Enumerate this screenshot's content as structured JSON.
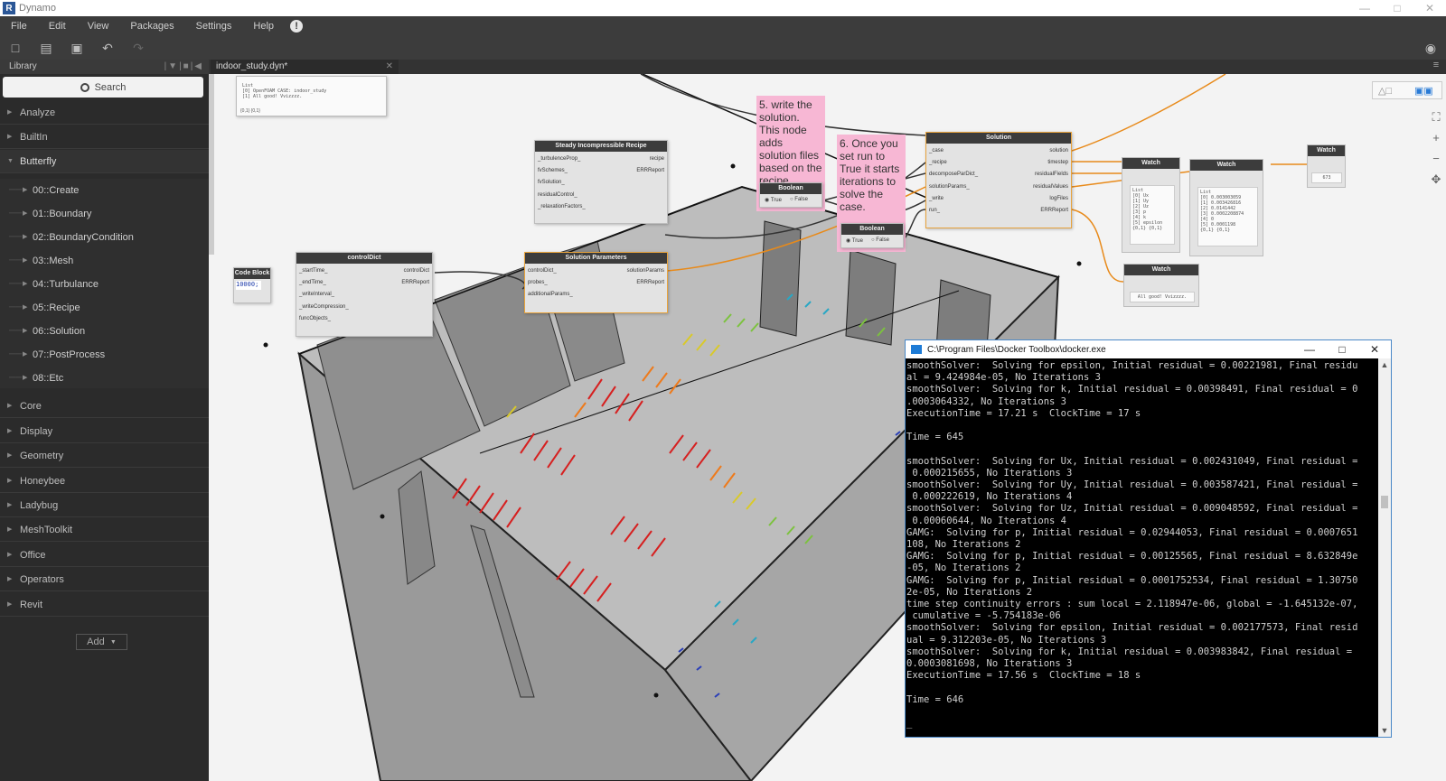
{
  "window": {
    "title": "Dynamo",
    "logo": "R"
  },
  "menu": [
    "File",
    "Edit",
    "View",
    "Packages",
    "Settings",
    "Help"
  ],
  "library": {
    "title": "Library",
    "search_placeholder": "Search",
    "categories_top": [
      "Analyze",
      "BuiltIn",
      "Butterfly"
    ],
    "butterfly_sub": [
      "00::Create",
      "01::Boundary",
      "02::BoundaryCondition",
      "03::Mesh",
      "04::Turbulance",
      "05::Recipe",
      "06::Solution",
      "07::PostProcess",
      "08::Etc"
    ],
    "categories_bottom": [
      "Core",
      "Display",
      "Geometry",
      "Honeybee",
      "Ladybug",
      "MeshToolkit",
      "Office",
      "Operators",
      "Revit"
    ],
    "add_label": "Add"
  },
  "doc_tab": {
    "name": "indoor_study.dyn*"
  },
  "nodes": {
    "list_preview": {
      "lines": [
        "List",
        "  [0] OpenFOAM CASE: indoor_study",
        "  [1] All good! Vvizzzz."
      ],
      "footer": "{0,1} {0,1}"
    },
    "code_block": {
      "title": "Code Block",
      "value": "10000;"
    },
    "control_dict": {
      "title": "controlDict",
      "inputs": [
        "_startTime_",
        "_endTime_",
        "_writeInterval_",
        "_writeCompression_",
        "funcObjects_"
      ],
      "outputs": [
        "controlDict",
        "ERRReport"
      ]
    },
    "steady_recipe": {
      "title": "Steady Incompressible Recipe",
      "inputs": [
        "_turbulenceProp_",
        "fvSchemes_",
        "fvSolution_",
        "residualControl_",
        "_relaxationFactors_"
      ],
      "outputs": [
        "recipe",
        "ERRReport"
      ]
    },
    "solution_params": {
      "title": "Solution Parameters",
      "inputs": [
        "controlDict_",
        "probes_",
        "additionalParams_"
      ],
      "outputs": [
        "solutionParams",
        "ERRReport"
      ]
    },
    "solution": {
      "title": "Solution",
      "inputs": [
        "_case",
        "_recipe",
        "decomposeParDict_",
        "solutionParams_",
        "_write",
        "run_"
      ],
      "outputs": [
        "solution",
        "timestep",
        "residualFields",
        "residualValues",
        "logFiles",
        "ERRReport"
      ]
    },
    "boolean1": {
      "title": "Boolean",
      "true_label": "True",
      "false_label": "False"
    },
    "boolean2": {
      "title": "Boolean",
      "true_label": "True",
      "false_label": "False"
    },
    "watch1": {
      "title": "Watch",
      "lines": [
        "List",
        "[0] Ux",
        "[1] Uy",
        "[2] Uz",
        "[3] p",
        "[4] k",
        "[5] epsilon"
      ],
      "footer": "{0,1} {0,1}"
    },
    "watch2": {
      "title": "Watch",
      "lines": [
        "List",
        "[0] 0.003003059",
        "[1] 0.003426816",
        "[2] 0.0141442",
        "[3] 0.0002208874",
        "[4] 0",
        "[5] 0.0001198"
      ],
      "footer": "{0,1} {0,1}"
    },
    "watch3": {
      "title": "Watch",
      "value": "673"
    },
    "watch4": {
      "title": "Watch",
      "value": "All good! Vvizzzz."
    }
  },
  "notes": {
    "note5": "5. write the solution. This node adds solution files based on the recipe.",
    "note6": "6. Once you set run to True it starts iterations to solve the case."
  },
  "console": {
    "title": "C:\\Program Files\\Docker Toolbox\\docker.exe",
    "lines": [
      "smoothSolver:  Solving for epsilon, Initial residual = 0.00221981, Final residu",
      "al = 9.424984e-05, No Iterations 3",
      "smoothSolver:  Solving for k, Initial residual = 0.00398491, Final residual = 0",
      ".0003064332, No Iterations 3",
      "ExecutionTime = 17.21 s  ClockTime = 17 s",
      "",
      "Time = 645",
      "",
      "smoothSolver:  Solving for Ux, Initial residual = 0.002431049, Final residual =",
      " 0.000215655, No Iterations 3",
      "smoothSolver:  Solving for Uy, Initial residual = 0.003587421, Final residual =",
      " 0.000222619, No Iterations 4",
      "smoothSolver:  Solving for Uz, Initial residual = 0.009048592, Final residual =",
      " 0.00060644, No Iterations 4",
      "GAMG:  Solving for p, Initial residual = 0.02944053, Final residual = 0.0007651",
      "108, No Iterations 2",
      "GAMG:  Solving for p, Initial residual = 0.00125565, Final residual = 8.632849e",
      "-05, No Iterations 2",
      "GAMG:  Solving for p, Initial residual = 0.0001752534, Final residual = 1.30750",
      "2e-05, No Iterations 2",
      "time step continuity errors : sum local = 2.118947e-06, global = -1.645132e-07,",
      " cumulative = -5.754183e-06",
      "smoothSolver:  Solving for epsilon, Initial residual = 0.002177573, Final resid",
      "ual = 9.312203e-05, No Iterations 3",
      "smoothSolver:  Solving for k, Initial residual = 0.003983842, Final residual =",
      "0.0003081698, No Iterations 3",
      "ExecutionTime = 17.56 s  ClockTime = 18 s",
      "",
      "Time = 646",
      "",
      "_"
    ]
  }
}
